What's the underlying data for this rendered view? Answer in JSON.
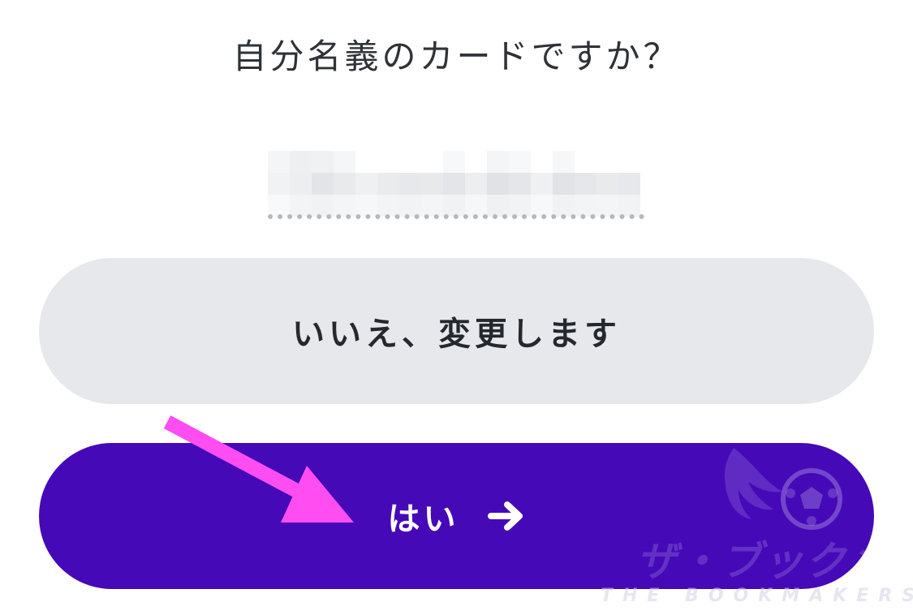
{
  "dialog": {
    "question": "自分名義のカードですか？",
    "masked_cardholder_name": ""
  },
  "buttons": {
    "no_label": "いいえ、変更します",
    "yes_label": "はい"
  },
  "icons": {
    "yes_arrow": "arrow-right-icon",
    "annotation": "pink-pointer-arrow-icon",
    "watermark_ball": "soccer-ball-icon"
  },
  "watermark": {
    "text": "ザ・ブックメーカーズ",
    "subtext": "THE BOOKMAKERS"
  },
  "colors": {
    "primary": "#4509b8",
    "secondary_button": "#e6e8eb",
    "annotation": "#ff4df2",
    "text": "#2f3337"
  }
}
